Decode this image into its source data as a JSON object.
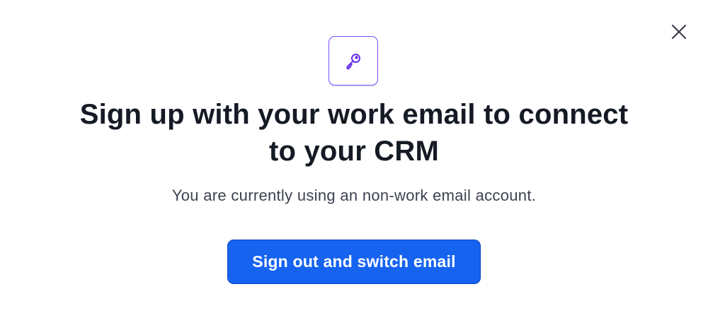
{
  "modal": {
    "title": "Sign up with your work email to connect to your CRM",
    "subtitle": "You are currently using an non-work email account.",
    "primary_button_label": "Sign out and switch email",
    "icons": {
      "badge": "key-icon",
      "close": "close-icon"
    }
  },
  "colors": {
    "accent_purple": "#7c4dff",
    "primary_blue": "#1663f0",
    "title_text": "#151a24",
    "subtitle_text": "#3d4250"
  }
}
